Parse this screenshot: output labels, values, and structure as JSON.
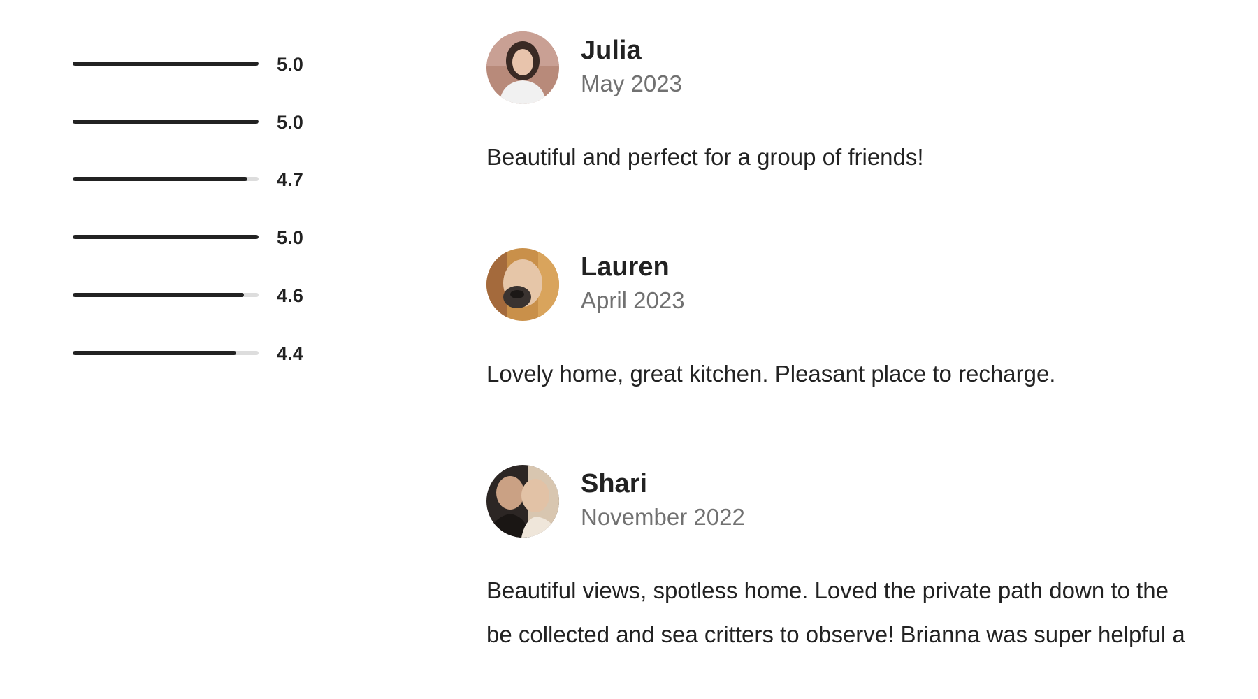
{
  "ratings": [
    {
      "value": "5.0",
      "fraction": 1.0
    },
    {
      "value": "5.0",
      "fraction": 1.0
    },
    {
      "value": "4.7",
      "fraction": 0.94
    },
    {
      "value": "5.0",
      "fraction": 1.0
    },
    {
      "value": "4.6",
      "fraction": 0.92
    },
    {
      "value": "4.4",
      "fraction": 0.88
    }
  ],
  "reviews": [
    {
      "name": "Julia",
      "date": "May 2023",
      "avatar": "julia-avatar",
      "lines": [
        "Beautiful and perfect for a group of friends!"
      ]
    },
    {
      "name": "Lauren",
      "date": "April 2023",
      "avatar": "lauren-avatar",
      "lines": [
        "Lovely home, great kitchen. Pleasant place to recharge."
      ]
    },
    {
      "name": "Shari",
      "date": "November 2022",
      "avatar": "shari-avatar",
      "lines": [
        "Beautiful views, spotless home. Loved the private path down to the",
        "be collected and sea critters to observe! Brianna was super helpful a"
      ]
    }
  ],
  "colors": {
    "text": "#222222",
    "muted": "#717171",
    "track": "#dddddd",
    "fill": "#222222"
  }
}
